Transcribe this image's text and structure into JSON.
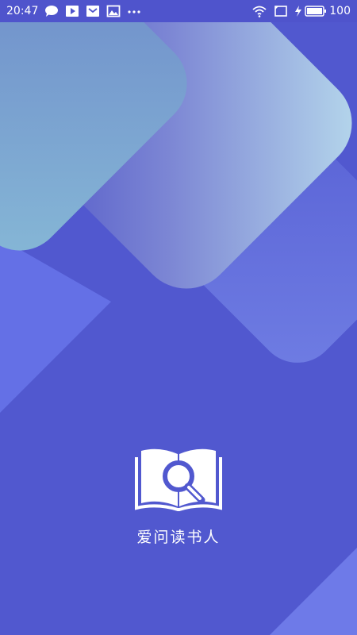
{
  "status_bar": {
    "time": "20:47",
    "battery_percent": "100",
    "left_icons": [
      "chat-bubble-icon",
      "play-icon",
      "mail-icon",
      "image-icon",
      "more-dots-icon"
    ],
    "right_icons": [
      "wifi-icon",
      "screen-rotate-icon",
      "charging-bolt-icon",
      "battery-icon"
    ]
  },
  "splash": {
    "app_name": "爱问读书人",
    "logo_icon": "book-search-icon"
  },
  "colors": {
    "background": "#5158cf",
    "status_bar": "#4f54cc",
    "text": "#ffffff"
  }
}
